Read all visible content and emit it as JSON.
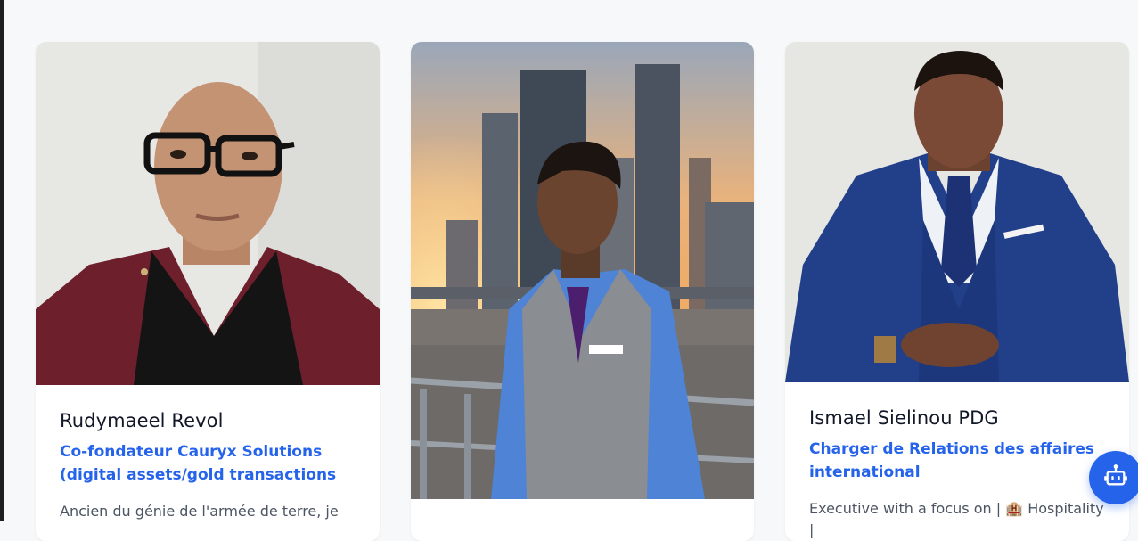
{
  "team": {
    "members": [
      {
        "name": "Rudymaeel Revol",
        "role": "Co-fondateur Cauryx Solutions (digital assets/gold transactions",
        "bio": "Ancien du génie de l'armée de terre, je"
      },
      {
        "name": "",
        "role": "",
        "bio": ""
      },
      {
        "name": "Ismael Sielinou PDG",
        "role": "Charger de Relations des affaires international",
        "bio": "Executive with a focus on | 🏨 Hospitality |"
      }
    ]
  },
  "chat": {
    "icon": "robot-icon"
  },
  "colors": {
    "accent": "#2563eb",
    "page_bg": "#f7f8fa",
    "card_bg": "#ffffff"
  }
}
